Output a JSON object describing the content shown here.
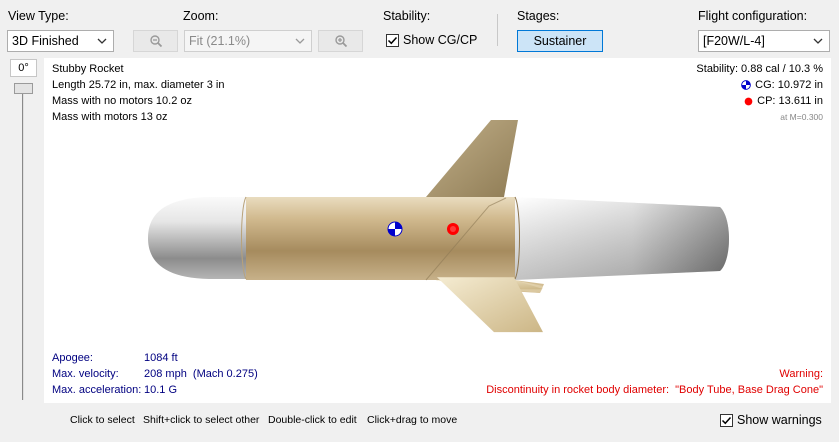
{
  "toolbar": {
    "view_type_label": "View Type:",
    "view_type_value": "3D Finished",
    "zoom_label": "Zoom:",
    "zoom_value": "Fit (21.1%)",
    "stability_label": "Stability:",
    "show_cgcp_label": "Show CG/CP",
    "show_cgcp_checked": true,
    "stages_label": "Stages:",
    "stage_button": "Sustainer",
    "flight_config_label": "Flight configuration:",
    "flight_config_value": "[F20W/L-4]"
  },
  "rotation": {
    "angle_label": "0°"
  },
  "rocket_info": {
    "name": "Stubby Rocket",
    "length": "Length 25.72 in, max. diameter 3 in",
    "mass_no_motors": "Mass with no motors 10.2 oz",
    "mass_with_motors": "Mass with motors 13 oz"
  },
  "stability_info": {
    "stability": "Stability: 0.88 cal / 10.3 %",
    "cg": "CG: 10.972 in",
    "cp": "CP: 13.611 in",
    "mach": "at M=0.300"
  },
  "flight_data": {
    "apogee_label": "Apogee:",
    "apogee_value": "1084 ft",
    "velocity_label": "Max. velocity:",
    "velocity_value": "208 mph  (Mach 0.275)",
    "accel_label": "Max. acceleration:",
    "accel_value": "10.1 G"
  },
  "warning": {
    "title": "Warning:",
    "message": "Discontinuity in rocket body diameter:  \"Body Tube, Base Drag Cone\""
  },
  "status_bar": {
    "click_select": "Click to select",
    "shift_click": "Shift+click to select other",
    "double_click": "Double-click to edit",
    "click_drag": "Click+drag to move",
    "show_warnings_label": "Show warnings",
    "show_warnings_checked": true
  },
  "colors": {
    "cg_marker": "#0000cc",
    "cp_marker": "#ff0000",
    "warning_text": "#e00000",
    "flight_text": "#000080",
    "selected_button": "#cce4f7"
  }
}
